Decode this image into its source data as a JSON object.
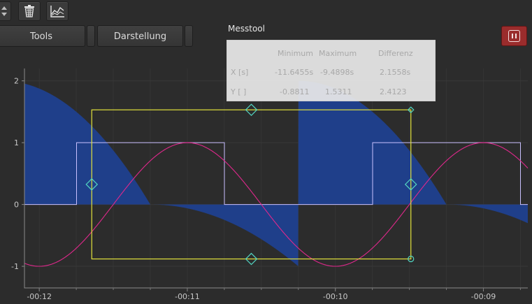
{
  "toolbar": {
    "tools_label": "Tools",
    "darstellung_label": "Darstellung"
  },
  "messtool": {
    "title": "Messtool",
    "headers": [
      "Minimum",
      "Maximum",
      "Differenz"
    ],
    "rows": [
      {
        "label": "X [s]",
        "minimum": "-11.6455s",
        "maximum": "-9.4898s",
        "differenz": "2.1558s"
      },
      {
        "label": "Y [ ]",
        "minimum": "-0.8811",
        "maximum": "1.5311",
        "differenz": "2.4123"
      }
    ]
  },
  "icons": {
    "spinner": "spinner-arrows-icon",
    "delete": "trash-basket-icon",
    "chart": "line-chart-icon",
    "pause": "pause-icon"
  },
  "colors": {
    "fill": "#1f3f8a",
    "square": "#c9c0ff",
    "sine": "#e0288c",
    "cursor": "#e2e23c",
    "handle": "#52d6c2",
    "pause_button": "#9a2c2c"
  },
  "chart_data": {
    "type": "line",
    "x_ticks": [
      "-00:12",
      "-00:11",
      "-00:10",
      "-00:09"
    ],
    "y_ticks": [
      "2",
      "1",
      "0",
      "-1"
    ],
    "xlim": [
      -12.1,
      -8.7
    ],
    "ylim": [
      -1.35,
      2.2
    ],
    "period": 2,
    "series": [
      {
        "style": "square",
        "amplitude": 1,
        "phase": 0.25
      },
      {
        "style": "sine",
        "amplitude": 1,
        "phase": -9.5
      },
      {
        "style": "area",
        "shape": "parabolic sawtooth",
        "peak": 2
      }
    ],
    "cursor_box": {
      "x_min": -11.6455,
      "x_max": -9.4898,
      "y_min": -0.8811,
      "y_max": 1.5311
    }
  }
}
